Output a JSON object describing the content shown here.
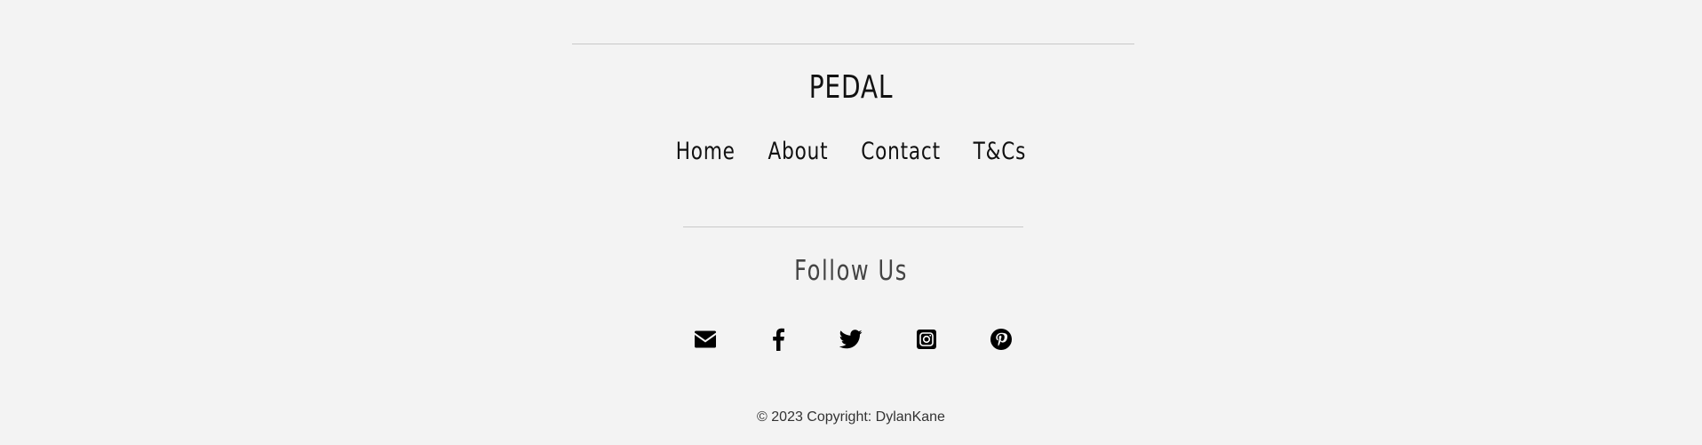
{
  "footer": {
    "brand": "PEDAL",
    "nav": [
      {
        "label": "Home"
      },
      {
        "label": "About"
      },
      {
        "label": "Contact"
      },
      {
        "label": "T&Cs"
      }
    ],
    "follow_heading": "Follow Us",
    "socials": [
      {
        "icon": "envelope-icon"
      },
      {
        "icon": "facebook-icon"
      },
      {
        "icon": "twitter-icon"
      },
      {
        "icon": "instagram-icon"
      },
      {
        "icon": "pinterest-icon"
      }
    ],
    "copyright": "© 2023 Copyright: DylanKane"
  },
  "colors": {
    "background": "#f3f3f3",
    "text": "#111111",
    "muted_text": "#444444",
    "divider": "#c8c8c8"
  }
}
